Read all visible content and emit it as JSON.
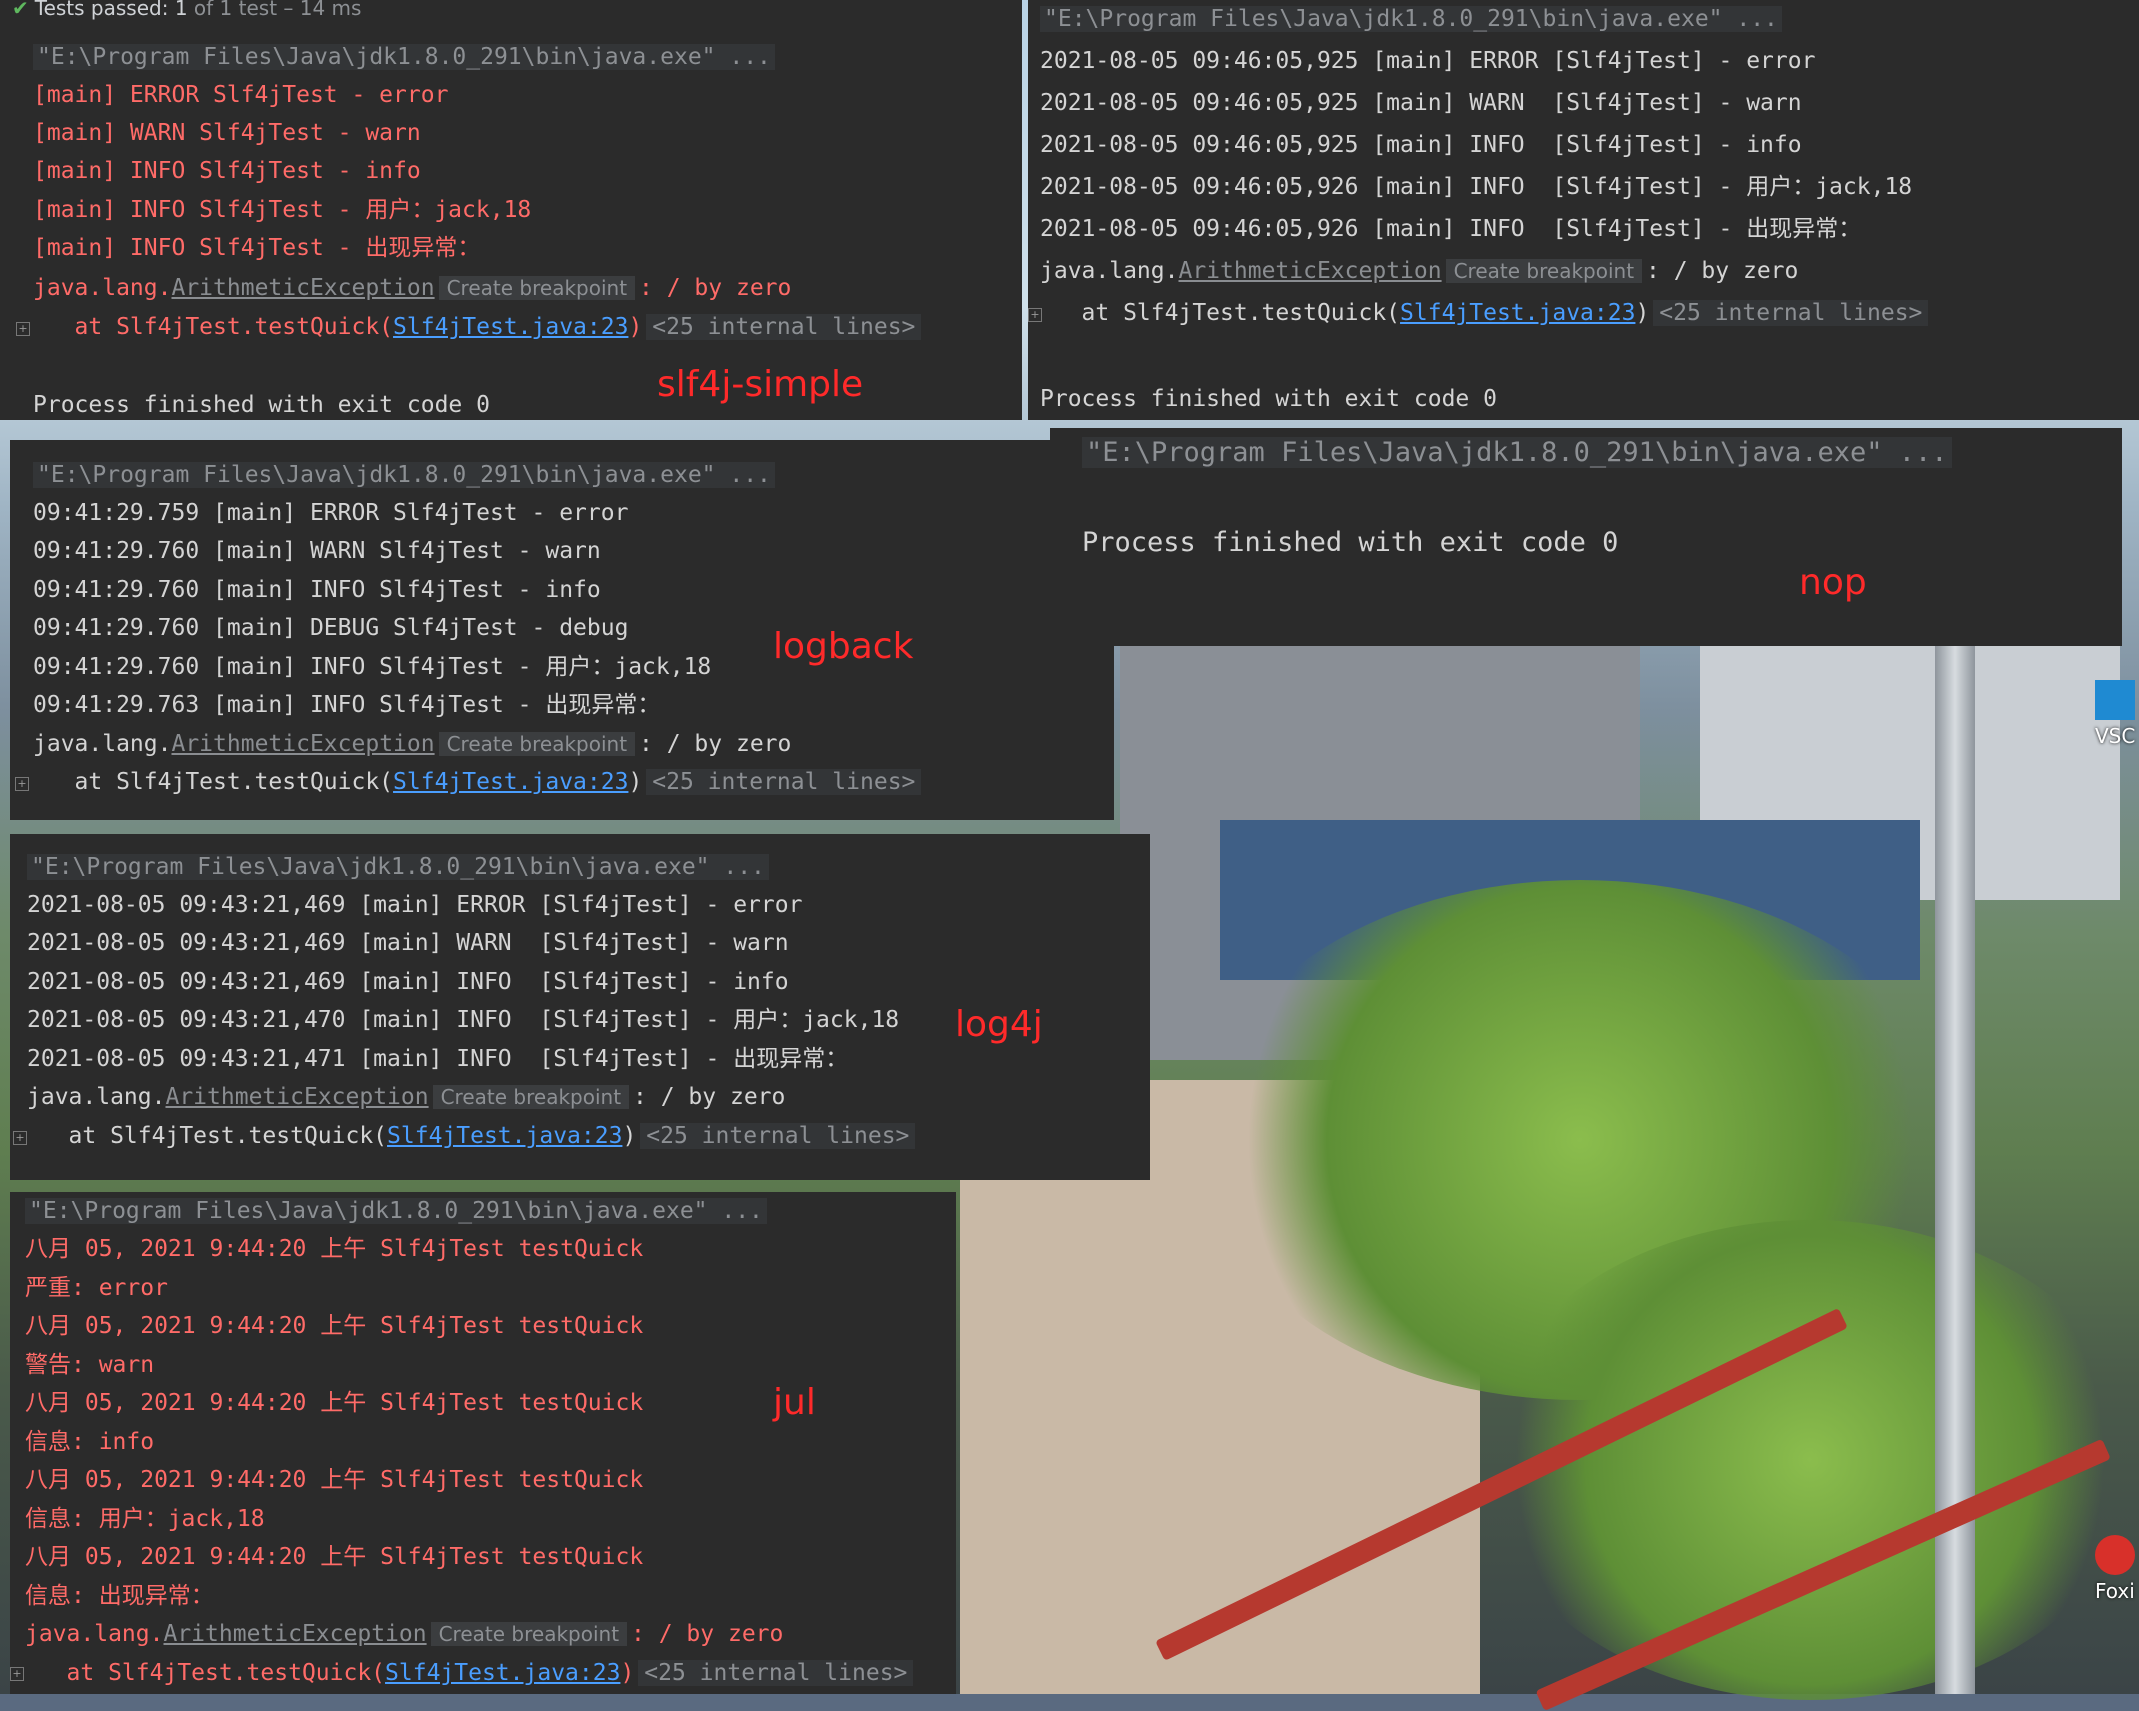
{
  "test_status": {
    "check": "✔",
    "passed": "Tests passed: 1",
    "rest": " of 1 test – 14 ms"
  },
  "common": {
    "java_cmd": "\"E:\\Program Files\\Java\\jdk1.8.0_291\\bin\\java.exe\" ...",
    "exc_prefix": "java.lang.",
    "exc_name": "ArithmeticException",
    "create_breakpoint": "Create breakpoint",
    "exc_suffix": ": / by zero",
    "at_prefix": "   at Slf4jTest.testQuick(",
    "at_link": "Slf4jTest.java:23",
    "at_suffix": ")",
    "internal_lines": "<25 internal lines>",
    "process_finished": "Process finished with exit code 0"
  },
  "panels": {
    "simple": {
      "label": "slf4j-simple",
      "lines": [
        "[main] ERROR Slf4jTest - error",
        "[main] WARN Slf4jTest - warn",
        "[main] INFO Slf4jTest - info",
        "[main] INFO Slf4jTest - 用户：jack,18",
        "[main] INFO Slf4jTest - 出现异常："
      ]
    },
    "log4j2": {
      "lines": [
        "2021-08-05 09:46:05,925 [main] ERROR [Slf4jTest] - error",
        "2021-08-05 09:46:05,925 [main] WARN  [Slf4jTest] - warn",
        "2021-08-05 09:46:05,925 [main] INFO  [Slf4jTest] - info",
        "2021-08-05 09:46:05,926 [main] INFO  [Slf4jTest] - 用户：jack,18",
        "2021-08-05 09:46:05,926 [main] INFO  [Slf4jTest] - 出现异常："
      ]
    },
    "logback": {
      "label": "logback",
      "lines": [
        "09:41:29.759 [main] ERROR Slf4jTest - error",
        "09:41:29.760 [main] WARN Slf4jTest - warn",
        "09:41:29.760 [main] INFO Slf4jTest - info",
        "09:41:29.760 [main] DEBUG Slf4jTest - debug",
        "09:41:29.760 [main] INFO Slf4jTest - 用户：jack,18",
        "09:41:29.763 [main] INFO Slf4jTest - 出现异常："
      ]
    },
    "nop": {
      "label": "nop"
    },
    "log4j": {
      "label": "log4j",
      "lines": [
        "2021-08-05 09:43:21,469 [main] ERROR [Slf4jTest] - error",
        "2021-08-05 09:43:21,469 [main] WARN  [Slf4jTest] - warn",
        "2021-08-05 09:43:21,469 [main] INFO  [Slf4jTest] - info",
        "2021-08-05 09:43:21,470 [main] INFO  [Slf4jTest] - 用户：jack,18",
        "2021-08-05 09:43:21,471 [main] INFO  [Slf4jTest] - 出现异常："
      ]
    },
    "jul": {
      "label": "jul",
      "lines": [
        "八月 05, 2021 9:44:20 上午 Slf4jTest testQuick",
        "严重: error",
        "八月 05, 2021 9:44:20 上午 Slf4jTest testQuick",
        "警告: warn",
        "八月 05, 2021 9:44:20 上午 Slf4jTest testQuick",
        "信息: info",
        "八月 05, 2021 9:44:20 上午 Slf4jTest testQuick",
        "信息: 用户：jack,18",
        "八月 05, 2021 9:44:20 上午 Slf4jTest testQuick",
        "信息: 出现异常："
      ]
    }
  },
  "desktop_icons": {
    "vscode": "VSC",
    "foxit": "Foxi"
  }
}
